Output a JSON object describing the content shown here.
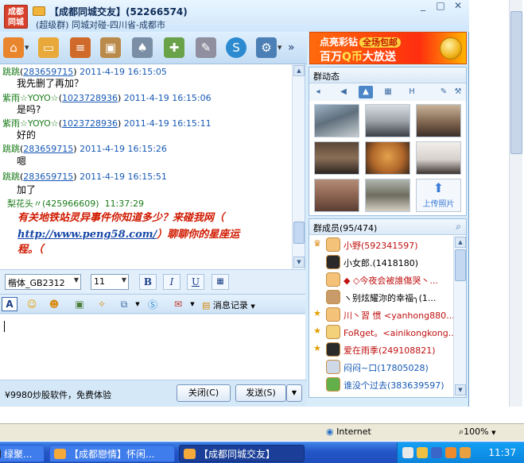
{
  "window": {
    "logo": "成都\n同城",
    "title": "【成都同城交友】(52266574)",
    "subtitle": "(超级群) 同城对碰-四川省-成都市",
    "controls": [
      "_",
      "□",
      "✕"
    ]
  },
  "toolbar": {
    "icons": [
      "home-icon",
      "folder-icon",
      "doc-icon",
      "screen-icon",
      "mic-icon",
      "add-icon",
      "tools-icon",
      "s-icon",
      "gear-icon"
    ],
    "more": "»"
  },
  "ad_banner": {
    "line1": "点亮彩钻",
    "pill": "全场包邮",
    "line2_prefix": "百万",
    "line2_q": "Q币",
    "line2_suffix": "大放送"
  },
  "chat": {
    "messages": [
      {
        "sender": "跳跳",
        "id": "283659715",
        "time": "2011-4-19 16:15:05",
        "body": "我先删了再加？"
      },
      {
        "sender": "紫雨☆YOYO☆",
        "id": "1023728936",
        "time": "2011-4-19 16:15:06",
        "body": "是吗?"
      },
      {
        "sender": "紫雨☆YOYO☆",
        "id": "1023728936",
        "time": "2011-4-19 16:15:11",
        "body": "好的"
      },
      {
        "sender": "跳跳",
        "id": "283659715",
        "time": "2011-4-19 16:15:26",
        "body": "嗯"
      },
      {
        "sender": "跳跳",
        "id": "283659715",
        "time": "2011-4-19 16:15:51",
        "body": "加了"
      }
    ],
    "last_sender": "梨花头〃(425966609)",
    "last_time": "11:37:29",
    "rich_line1": "有关地铁站灵异事件你知道多少？来碰我网（",
    "rich_link": "http://www.peng58.com/",
    "rich_line2_suffix": "）聊聊你的星座运",
    "rich_line3": "程。（"
  },
  "format": {
    "font": "楷体_GB2312",
    "size": "11",
    "bold": "B",
    "italic": "I",
    "underline": "U"
  },
  "toolbar2": {
    "history_label": "消息记录"
  },
  "bottom": {
    "ad_text": "¥9980炒股软件，免费体验",
    "close_label": "关闭(C)",
    "send_label": "发送(S)"
  },
  "group_panel": {
    "title": "群动态",
    "upload_label": "上传照片"
  },
  "member_panel": {
    "title": "群成员(95/474)",
    "members": [
      {
        "name": "小野(592341597)",
        "style": "red",
        "badge": "♛"
      },
      {
        "name": "小女郎.(1418180)",
        "style": "black",
        "badge": ""
      },
      {
        "name": "◆ ◇今夜会被誰傷哭丶...",
        "style": "red",
        "badge": ""
      },
      {
        "name": "ヽ别炫耀沵的幸福╮(1...",
        "style": "black",
        "badge": ""
      },
      {
        "name": "川丶習 惯 <yanhong880...",
        "style": "red",
        "badge": "★"
      },
      {
        "name": "FoRget。<ainikongkong....",
        "style": "red",
        "badge": "★"
      },
      {
        "name": "爱在雨季(249108821)",
        "style": "red",
        "badge": "★"
      },
      {
        "name": "闷闷~口(17805028)",
        "style": "blue",
        "badge": ""
      },
      {
        "name": "谁没个过去(383639597)",
        "style": "blue",
        "badge": ""
      }
    ]
  },
  "ie_status": {
    "zone": "Internet",
    "zoom": "100%"
  },
  "taskbar": {
    "tasks": [
      {
        "label": "绿聚...",
        "active": false
      },
      {
        "label": "【成都戀情】怀闲...",
        "active": false
      },
      {
        "label": "【成都同城交友】",
        "active": true
      }
    ],
    "clock": "11:37"
  }
}
